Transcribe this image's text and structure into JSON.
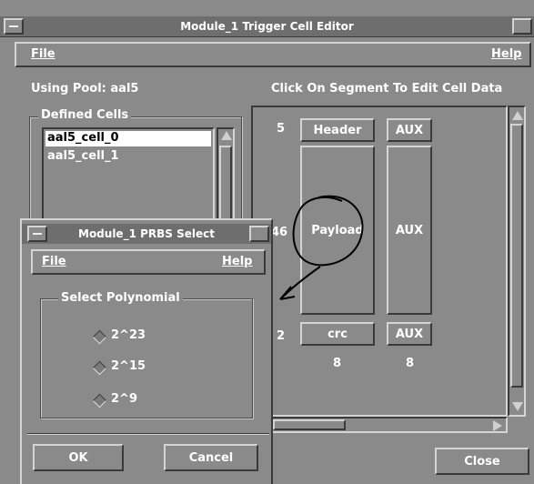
{
  "main_window": {
    "title": "Module_1 Trigger Cell Editor",
    "menu": {
      "file": "File",
      "help": "Help"
    },
    "pool_label": "Using Pool: aal5",
    "instruction": "Click On Segment To Edit Cell Data",
    "defined_cells": {
      "legend": "Defined Cells",
      "items": [
        "aal5_cell_0",
        "aal5_cell_1"
      ],
      "selected_index": 0
    },
    "segments": {
      "header": {
        "count": "5",
        "label": "Header",
        "aux": "AUX"
      },
      "payload": {
        "count": "46",
        "label": "Payload",
        "aux": "AUX"
      },
      "crc": {
        "count": "2",
        "label": "crc",
        "aux": "AUX"
      },
      "col_totals": [
        "8",
        "8"
      ]
    },
    "close_label": "Close"
  },
  "dialog": {
    "title": "Module_1 PRBS Select",
    "menu": {
      "file": "File",
      "help": "Help"
    },
    "legend": "Select Polynomial",
    "options": [
      "2^23",
      "2^15",
      "2^9"
    ],
    "ok_label": "OK",
    "cancel_label": "Cancel"
  },
  "colors": {
    "background": "#8a8a8a",
    "titlebar": "#6e6e6e",
    "selection": "#ffffff"
  }
}
